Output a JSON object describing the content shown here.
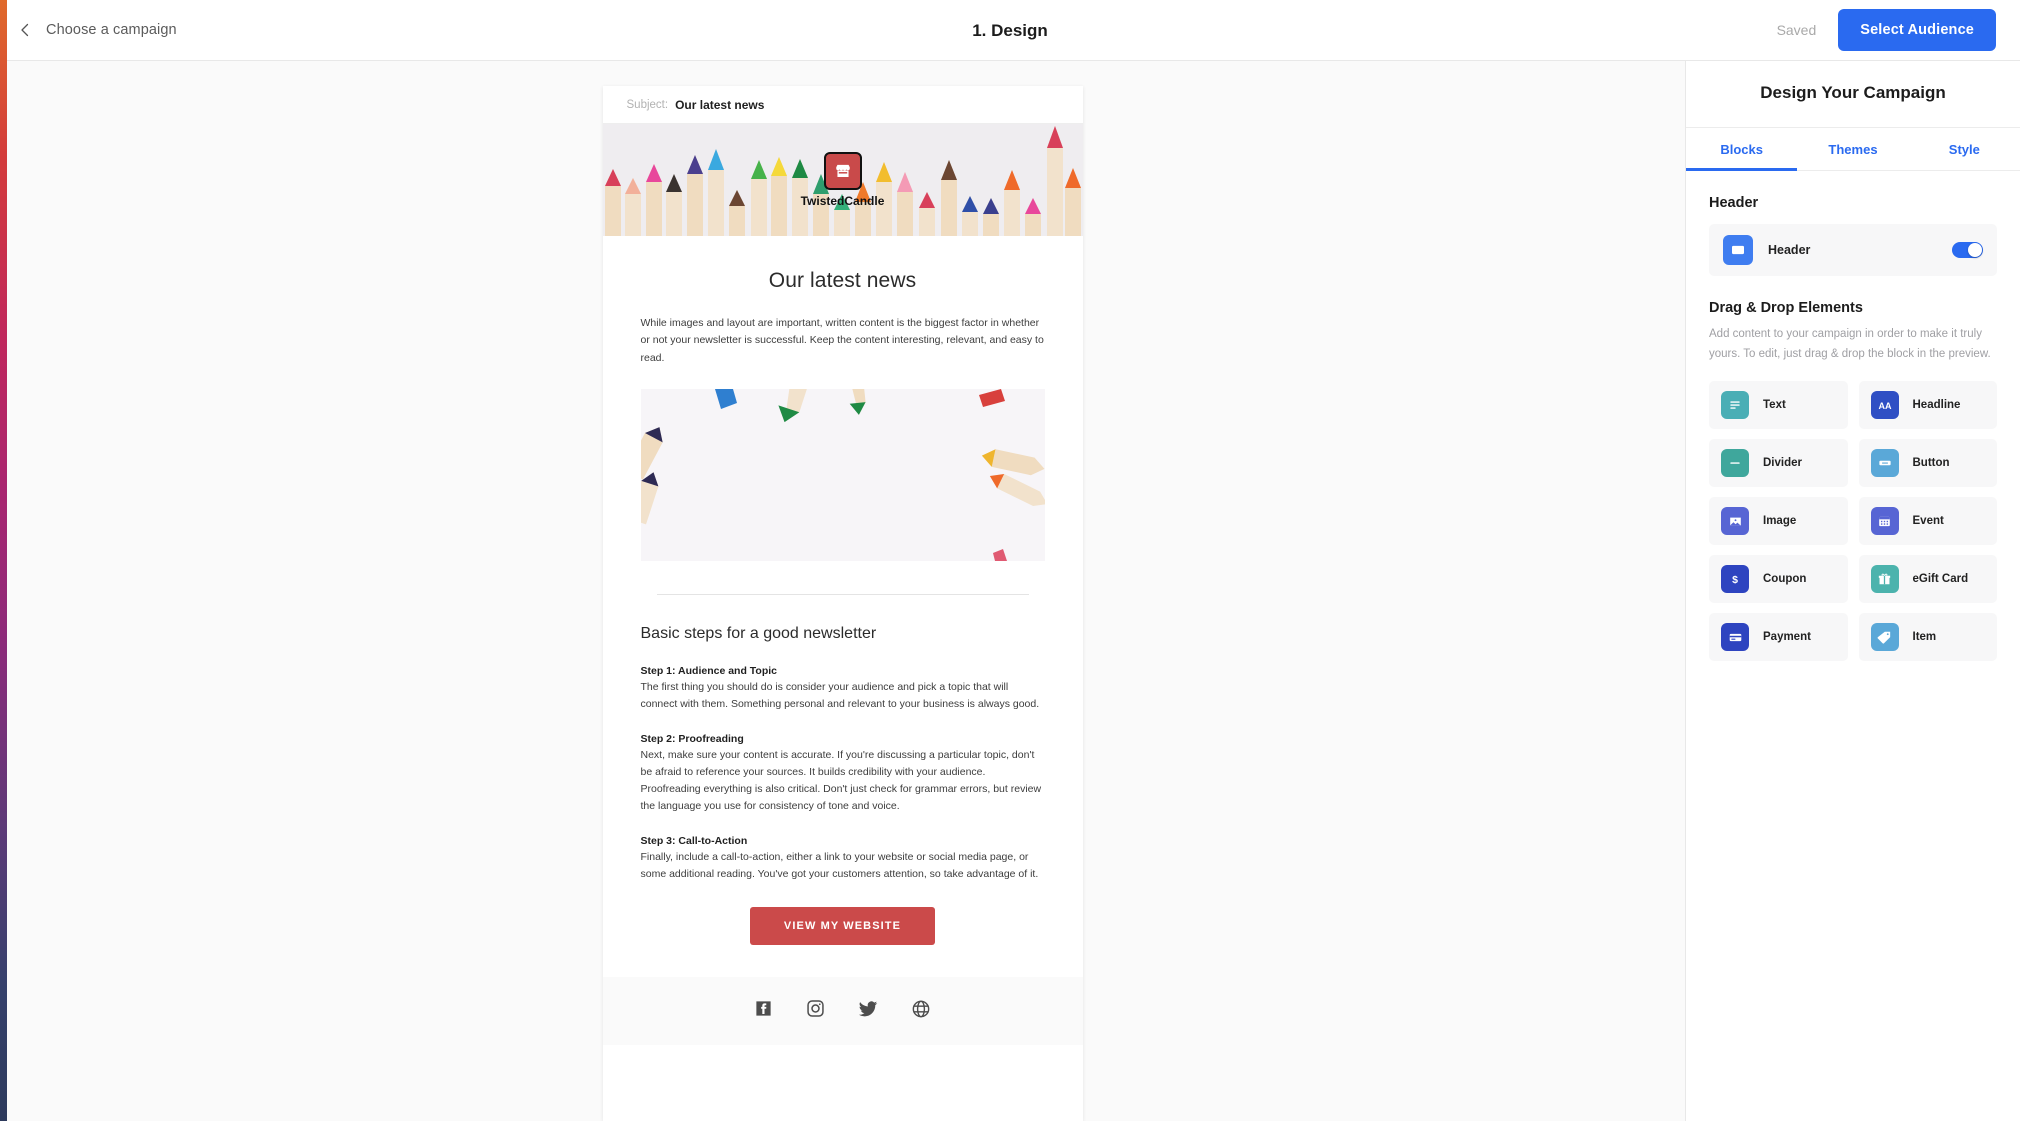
{
  "topbar": {
    "back_label": "Choose a campaign",
    "back_icon": "chevron-left-icon",
    "title": "1. Design",
    "saved_label": "Saved",
    "primary_button": "Select Audience",
    "primary_color": "#2a6af0"
  },
  "email": {
    "subject_key": "Subject:",
    "subject_value": "Our latest news",
    "brand_name": "TwistedCandle",
    "logo_icon": "store-icon",
    "logo_color": "#c94a4a",
    "headline": "Our latest news",
    "intro": "While images and layout are important, written content is the biggest factor in whether or not your newsletter is successful. Keep the content interesting, relevant, and easy to read.",
    "section_heading": "Basic steps for a good newsletter",
    "steps": [
      {
        "title": "Step 1: Audience and Topic",
        "text": "The first thing you should do is consider your audience and pick a topic that will connect with them. Something personal and relevant to your business is always good."
      },
      {
        "title": "Step 2: Proofreading",
        "text": "Next, make sure your content is accurate. If you're discussing a particular topic, don't be afraid to reference your sources. It builds credibility with your audience. Proofreading everything is also critical. Don't just check for grammar errors, but review the language you use for consistency of tone and voice."
      },
      {
        "title": "Step 3: Call-to-Action",
        "text": "Finally, include a call-to-action, either a link to your website or social media page, or some additional reading. You've got your customers attention, so take advantage of it."
      }
    ],
    "cta_label": "VIEW MY WEBSITE",
    "cta_color": "#cb4a4a",
    "social_icons": [
      "facebook-icon",
      "instagram-icon",
      "twitter-icon",
      "globe-icon"
    ]
  },
  "panel": {
    "title": "Design Your Campaign",
    "tabs": [
      {
        "label": "Blocks",
        "active": true
      },
      {
        "label": "Themes",
        "active": false
      },
      {
        "label": "Style",
        "active": false
      }
    ],
    "header_section": {
      "title": "Header",
      "row_label": "Header",
      "row_icon": "header-block-icon",
      "toggle_on": true
    },
    "dragdrop": {
      "title": "Drag & Drop Elements",
      "description": "Add content to your campaign in order to make it truly yours. To edit, just drag & drop the block in the preview.",
      "blocks": [
        {
          "label": "Text",
          "icon": "text-lines-icon",
          "color": "#4aaeb5"
        },
        {
          "label": "Headline",
          "icon": "aa-icon",
          "color": "#2f4fc4"
        },
        {
          "label": "Divider",
          "icon": "divider-dash-icon",
          "color": "#3fa79c"
        },
        {
          "label": "Button",
          "icon": "button-icon",
          "color": "#5aa8d8"
        },
        {
          "label": "Image",
          "icon": "image-icon",
          "color": "#5765d4"
        },
        {
          "label": "Event",
          "icon": "calendar-icon",
          "color": "#5765d4"
        },
        {
          "label": "Coupon",
          "icon": "dollar-icon",
          "color": "#2e44c0"
        },
        {
          "label": "eGift Card",
          "icon": "gift-icon",
          "color": "#4cb3ad"
        },
        {
          "label": "Payment",
          "icon": "credit-card-icon",
          "color": "#2e44c0"
        },
        {
          "label": "Item",
          "icon": "tag-icon",
          "color": "#5aa8d8"
        }
      ]
    }
  }
}
